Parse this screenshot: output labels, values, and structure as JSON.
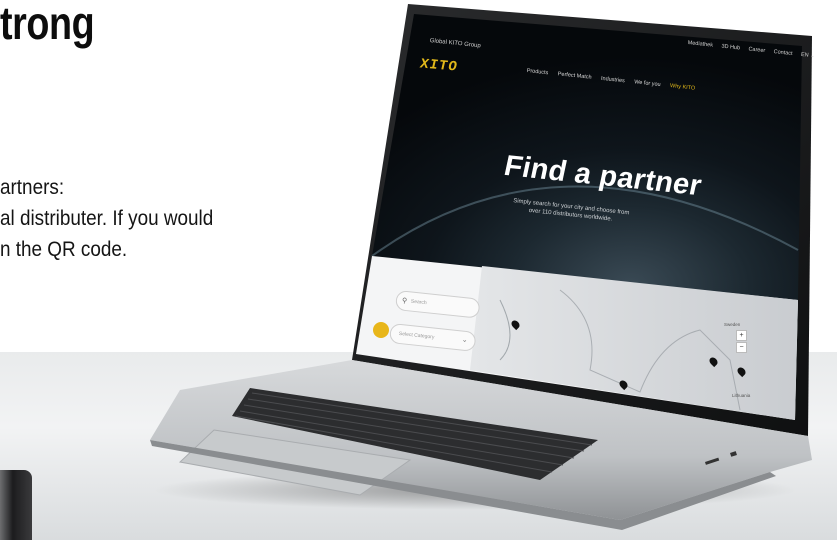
{
  "headline": "trong",
  "body_lines": [
    "artners:",
    "al distributer. If you would",
    "n the QR code."
  ],
  "laptop_screen": {
    "top_left_links": "Global   KITO Group",
    "brand": "XITO",
    "menu": [
      "Products",
      "Perfect Match",
      "Industries",
      "We for you",
      "Why KITO"
    ],
    "utility": [
      "Mediathek",
      "3D Hub",
      "Career",
      "Contact",
      "EN ⌄"
    ],
    "hero_title": "Find a partner",
    "hero_subtitle": "Simply search for your city and choose from over 110 distributors worldwide.",
    "search_placeholder": "Search",
    "select_placeholder": "Select Category",
    "map_labels": [
      "Sweden",
      "Lithuania"
    ],
    "accent_color": "#e1b81a"
  }
}
